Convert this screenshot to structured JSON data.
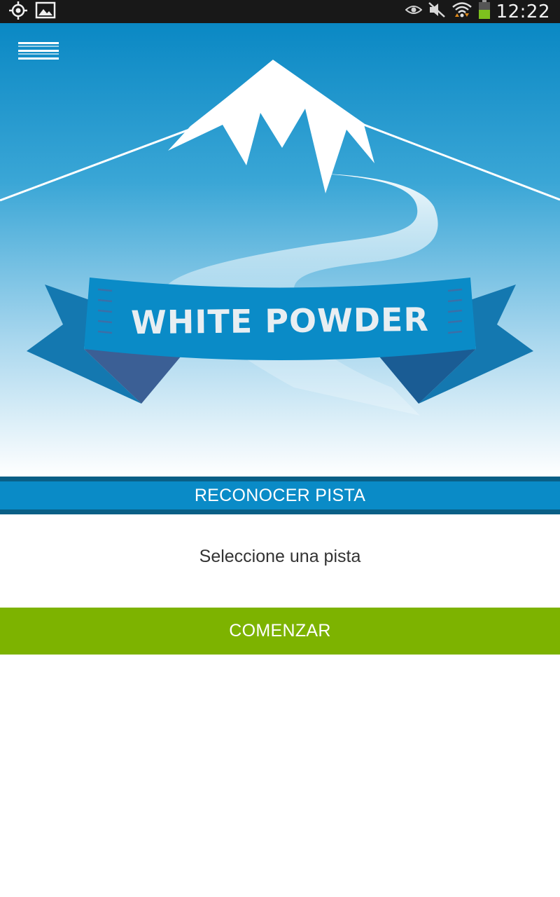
{
  "status_bar": {
    "time": "12:22",
    "icons": [
      "location-icon",
      "image-icon",
      "eye-icon",
      "mute-icon",
      "wifi-icon",
      "battery-icon"
    ]
  },
  "app": {
    "logo_text": "WHITE POWDER",
    "menu_icon": "hamburger-menu-icon"
  },
  "section": {
    "title": "RECONOCER PISTA"
  },
  "track": {
    "select_label": "Seleccione una pista"
  },
  "actions": {
    "start_label": "COMENZAR"
  },
  "colors": {
    "sky_top": "#0a88c4",
    "banner_blue": "#0a8bc7",
    "banner_dark": "#0a5f86",
    "start_green": "#7db300",
    "status_bar": "#181818"
  }
}
